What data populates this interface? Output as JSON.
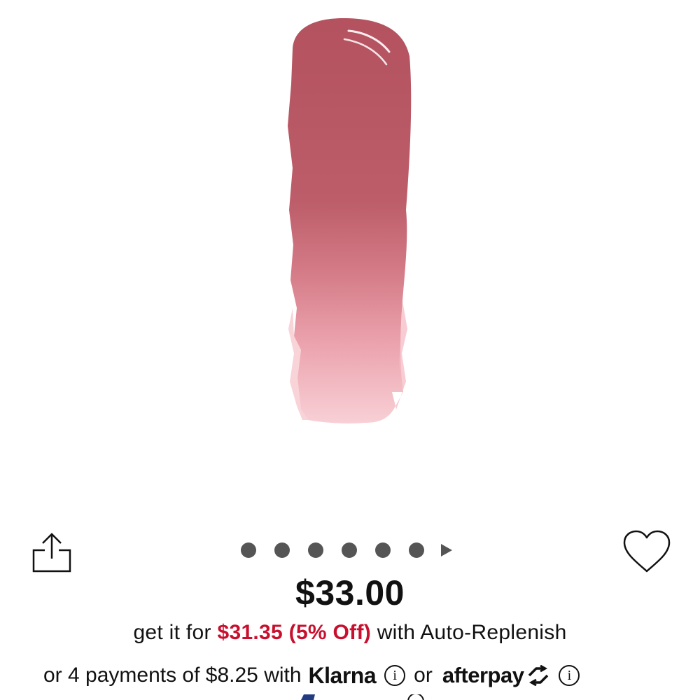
{
  "product_image": {
    "swatch_color": "#b85c68",
    "swatch_light_color": "#f2bcc4"
  },
  "carousel": {
    "dot_count": 6,
    "has_next_arrow": true
  },
  "price": {
    "current": "$33.00",
    "auto_prefix": "get it for",
    "auto_sale": "$31.35 (5% Off)",
    "auto_suffix": "with Auto-Replenish",
    "sale_color": "#c8102e"
  },
  "payments": {
    "prefix": "or 4 payments of $8.25 with",
    "klarna": "Klarna",
    "or_word": "or",
    "afterpay": "afterpay",
    "info_glyph": "i"
  },
  "icons": {
    "share": "share-icon",
    "wishlist": "heart-icon",
    "info": "info-icon"
  }
}
